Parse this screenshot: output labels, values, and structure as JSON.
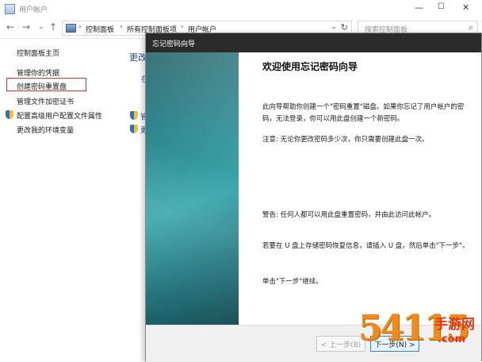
{
  "window": {
    "title": "用户帐户",
    "controls": {
      "minimize": "—",
      "maximize": "☐",
      "close": "✕"
    }
  },
  "navigation": {
    "back": "←",
    "forward": "→",
    "dropdown": "⌄",
    "up": "↑"
  },
  "address": {
    "breadcrumbs": [
      "控制面板",
      "所有控制面板项",
      "用户帐户"
    ],
    "separator": "›",
    "dropdown": "⌄",
    "refresh": "↻"
  },
  "search": {
    "placeholder": "搜索控制面板",
    "icon": "⌕"
  },
  "sidebar": {
    "items": [
      {
        "label": "控制面板主页"
      },
      {
        "label": "管理你的凭据"
      },
      {
        "label": "创建密码重置盘",
        "highlighted": true
      },
      {
        "label": "管理文件加密证书"
      },
      {
        "label": "配置高级用户配置文件属性",
        "shield": true
      },
      {
        "label": "更改我的环境变量"
      }
    ]
  },
  "main_background": {
    "heading_fragment": "更改",
    "link_fragment": "在",
    "shield_fragment_1": "管",
    "shield_fragment_2": "更"
  },
  "wizard": {
    "title": "忘记密码向导",
    "heading": "欢迎使用忘记密码向导",
    "paragraphs": [
      "此向导帮助你创建一个\"密码重置\"磁盘。如果你忘记了用户帐户的密码，无法登录，你可以用此盘创建一个新密码。",
      "注意: 无论你更改密码多少次，你只需要创建此盘一次。",
      "警告: 任何人都可以用此盘重置密码，并由此访问此帐户。",
      "若要在 U 盘上存储密码恢复信息，请插入 U 盘，然后单击\"下一步\"。",
      "单击\"下一步\"继续。"
    ],
    "buttons": {
      "back": "< 上一步(B)",
      "next": "下一步(N) >"
    }
  },
  "watermark": {
    "logo": "54115",
    "site": "手游网",
    "url": ".com"
  },
  "colors": {
    "accent": "#1d4fa0",
    "highlight_border": "#c0392b",
    "wizard_side": "#2e8a90"
  }
}
